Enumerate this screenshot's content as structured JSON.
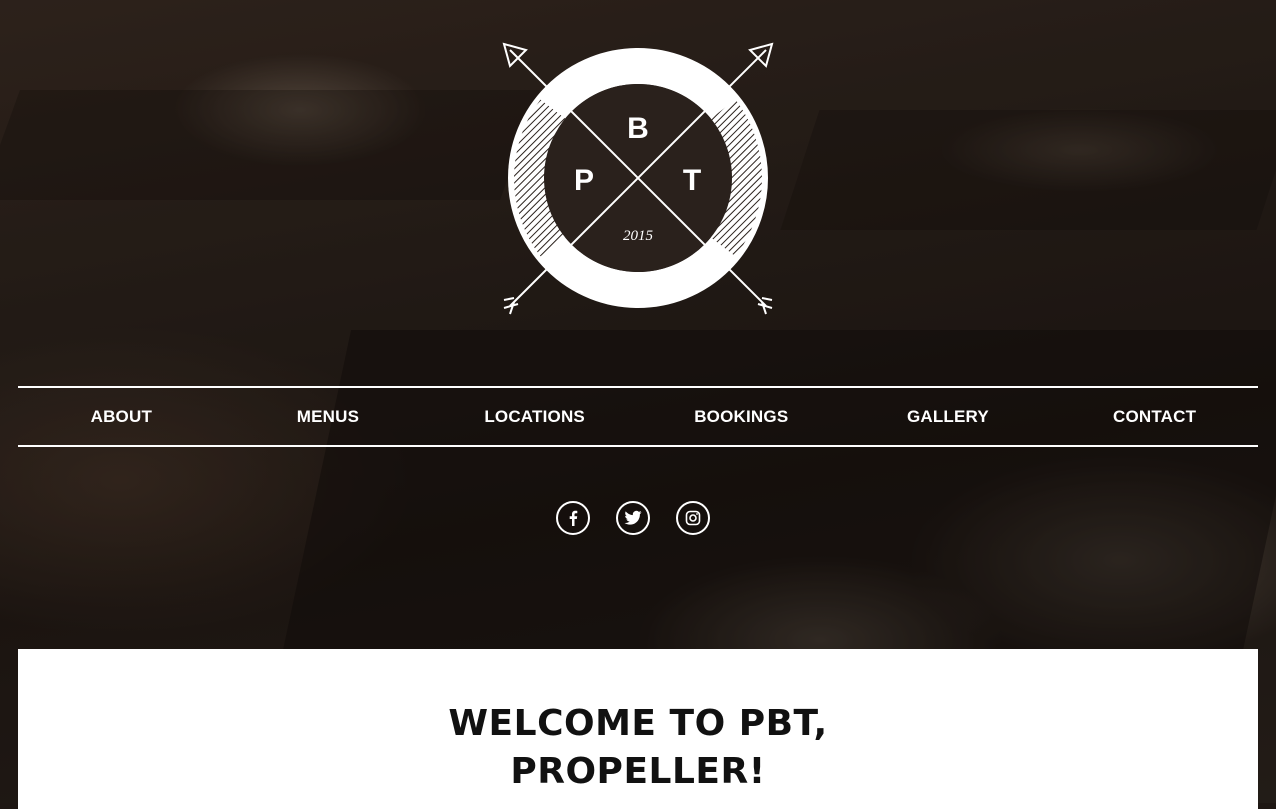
{
  "logo": {
    "letters": [
      "B",
      "P",
      "T"
    ],
    "year": "2015"
  },
  "nav": {
    "items": [
      {
        "label": "ABOUT"
      },
      {
        "label": "MENUS"
      },
      {
        "label": "LOCATIONS"
      },
      {
        "label": "BOOKINGS"
      },
      {
        "label": "GALLERY"
      },
      {
        "label": "CONTACT"
      }
    ]
  },
  "social": [
    {
      "icon": "facebook-icon"
    },
    {
      "icon": "twitter-icon"
    },
    {
      "icon": "instagram-icon"
    }
  ],
  "welcome": {
    "line1": "WELCOME TO PBT,",
    "line2": "PROPELLER!"
  },
  "colors": {
    "text_light": "#ffffff",
    "text_dark": "#111111",
    "panel": "#ffffff"
  }
}
